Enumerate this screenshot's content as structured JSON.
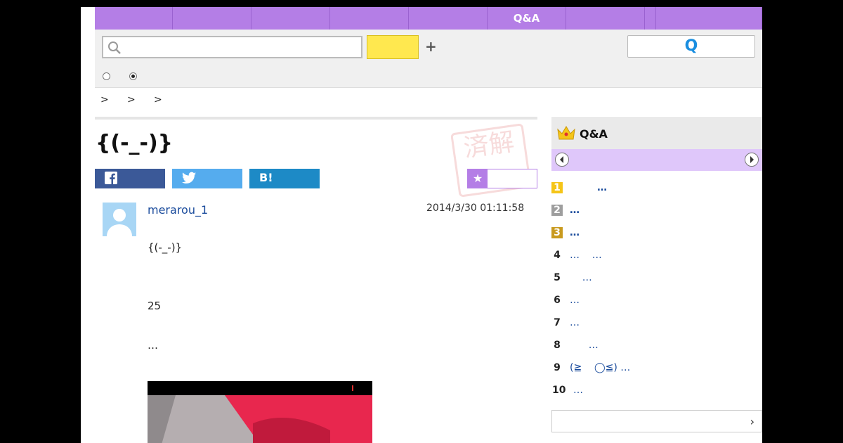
{
  "nav": {
    "items": [
      "",
      "",
      "",
      "",
      "",
      "Q&A",
      "",
      "",
      ""
    ]
  },
  "search": {
    "placeholder": "",
    "button_label": "",
    "plus_label": "+",
    "q_button_label": "Q"
  },
  "radios": [
    {
      "checked": false
    },
    {
      "checked": true
    }
  ],
  "breadcrumb": {
    "separators": [
      ">",
      ">",
      ">"
    ]
  },
  "question": {
    "title": "{(-_-)}",
    "stamp_text": "済解",
    "share": {
      "facebook_icon": "facebook-icon",
      "twitter_icon": "twitter-icon",
      "hatena_label": "B!"
    },
    "favorite_icon": "star-icon",
    "username": "merarou_1",
    "datetime": "2014/3/30  01:11:58",
    "body": [
      "{(-_-)}",
      "25",
      "…"
    ]
  },
  "ranking": {
    "title": "Q&A",
    "items": [
      {
        "rank": "1",
        "text": "        …",
        "bold": true
      },
      {
        "rank": "2",
        "text": "…",
        "bold": true
      },
      {
        "rank": "3",
        "text": "…",
        "bold": true
      },
      {
        "rank": "4",
        "text": "…    …",
        "bold": false
      },
      {
        "rank": "5",
        "text": "    …",
        "bold": false
      },
      {
        "rank": "6",
        "text": "…",
        "bold": false
      },
      {
        "rank": "7",
        "text": "…",
        "bold": false
      },
      {
        "rank": "8",
        "text": "      …",
        "bold": false
      },
      {
        "rank": "9",
        "text": "(≧    ◯≦) …",
        "bold": false
      },
      {
        "rank": "10",
        "text": "…",
        "bold": false
      }
    ],
    "more_chevron": "›"
  },
  "colors": {
    "accent_purple": "#b47ee6",
    "search_yellow": "#ffe84f",
    "rank1": "#f5c518",
    "rank2": "#9e9e9e",
    "rank3": "#c99a1e"
  }
}
